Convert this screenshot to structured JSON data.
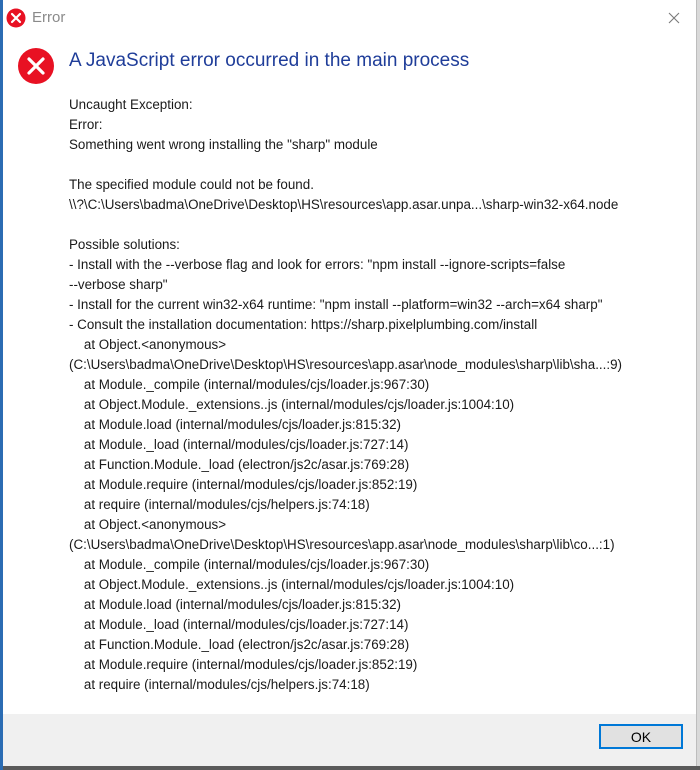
{
  "window": {
    "title": "Error"
  },
  "dialog": {
    "heading": "A JavaScript error occurred in the main process",
    "lines": [
      "Uncaught Exception:",
      "Error:",
      "Something went wrong installing the \"sharp\" module",
      "",
      "The specified module could not be found.",
      "\\\\?\\C:\\Users\\badma\\OneDrive\\Desktop\\HS\\resources\\app.asar.unpa...\\sharp-win32-x64.node",
      "",
      "Possible solutions:",
      "- Install with the --verbose flag and look for errors: \"npm install --ignore-scripts=false",
      "--verbose sharp\"",
      "- Install for the current win32-x64 runtime: \"npm install --platform=win32 --arch=x64 sharp\"",
      "- Consult the installation documentation: https://sharp.pixelplumbing.com/install",
      "    at Object.<anonymous>",
      "(C:\\Users\\badma\\OneDrive\\Desktop\\HS\\resources\\app.asar\\node_modules\\sharp\\lib\\sha...:9)",
      "    at Module._compile (internal/modules/cjs/loader.js:967:30)",
      "    at Object.Module._extensions..js (internal/modules/cjs/loader.js:1004:10)",
      "    at Module.load (internal/modules/cjs/loader.js:815:32)",
      "    at Module._load (internal/modules/cjs/loader.js:727:14)",
      "    at Function.Module._load (electron/js2c/asar.js:769:28)",
      "    at Module.require (internal/modules/cjs/loader.js:852:19)",
      "    at require (internal/modules/cjs/helpers.js:74:18)",
      "    at Object.<anonymous>",
      "(C:\\Users\\badma\\OneDrive\\Desktop\\HS\\resources\\app.asar\\node_modules\\sharp\\lib\\co...:1)",
      "    at Module._compile (internal/modules/cjs/loader.js:967:30)",
      "    at Object.Module._extensions..js (internal/modules/cjs/loader.js:1004:10)",
      "    at Module.load (internal/modules/cjs/loader.js:815:32)",
      "    at Module._load (internal/modules/cjs/loader.js:727:14)",
      "    at Function.Module._load (electron/js2c/asar.js:769:28)",
      "    at Module.require (internal/modules/cjs/loader.js:852:19)",
      "    at require (internal/modules/cjs/helpers.js:74:18)"
    ]
  },
  "buttons": {
    "ok_label": "OK"
  },
  "icons": {
    "title_icon": "error-icon",
    "dialog_icon": "error-icon",
    "close_icon": "close-icon"
  },
  "colors": {
    "error_red": "#e81123",
    "heading_blue": "#1f3d99",
    "button_border": "#0078d7"
  }
}
